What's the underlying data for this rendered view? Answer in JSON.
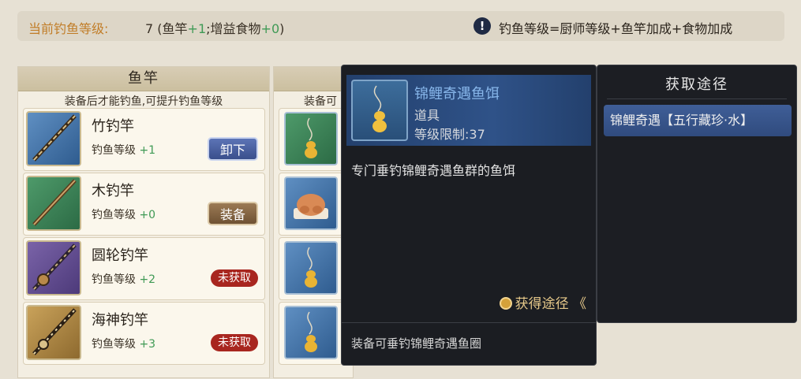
{
  "header": {
    "level_label": "当前钓鱼等级:",
    "level_value": "7",
    "level_open": "(鱼竿",
    "level_rod_bonus": "+1",
    "level_mid": ";增益食物",
    "level_food_bonus": "+0",
    "level_close": ")",
    "info_glyph": "!",
    "formula": "钓鱼等级=厨师等级+鱼竿加成+食物加成"
  },
  "rod_panel": {
    "title": "鱼竿",
    "hint": "装备后才能钓鱼,可提升钓鱼等级",
    "items": [
      {
        "name": "竹钓竿",
        "stat_label": "钓鱼等级",
        "bonus": "+1",
        "action": "卸下"
      },
      {
        "name": "木钓竿",
        "stat_label": "钓鱼等级",
        "bonus": "+0",
        "action": "装备"
      },
      {
        "name": "圆轮钓竿",
        "stat_label": "钓鱼等级",
        "bonus": "+2",
        "action": "未获取"
      },
      {
        "name": "海神钓竿",
        "stat_label": "钓鱼等级",
        "bonus": "+3",
        "action": "未获取"
      }
    ]
  },
  "bait_panel": {
    "hint": "装备可"
  },
  "tooltip": {
    "name": "锦鲤奇遇鱼饵",
    "type": "道具",
    "level_limit": "等级限制:37",
    "description": "专门垂钓锦鲤奇遇鱼群的鱼饵",
    "obtain_label": "获得途径",
    "obtain_arrow": "《",
    "footer": "装备可垂钓锦鲤奇遇鱼圈"
  },
  "source_panel": {
    "title": "获取途径",
    "items": [
      "锦鲤奇遇【五行藏珍·水】"
    ]
  },
  "colors": {
    "accent_gold": "#c17d28",
    "bonus_green": "#3f9a55",
    "tooltip_title_blue": "#87b6ea",
    "unobtained_red": "#a8261f"
  }
}
